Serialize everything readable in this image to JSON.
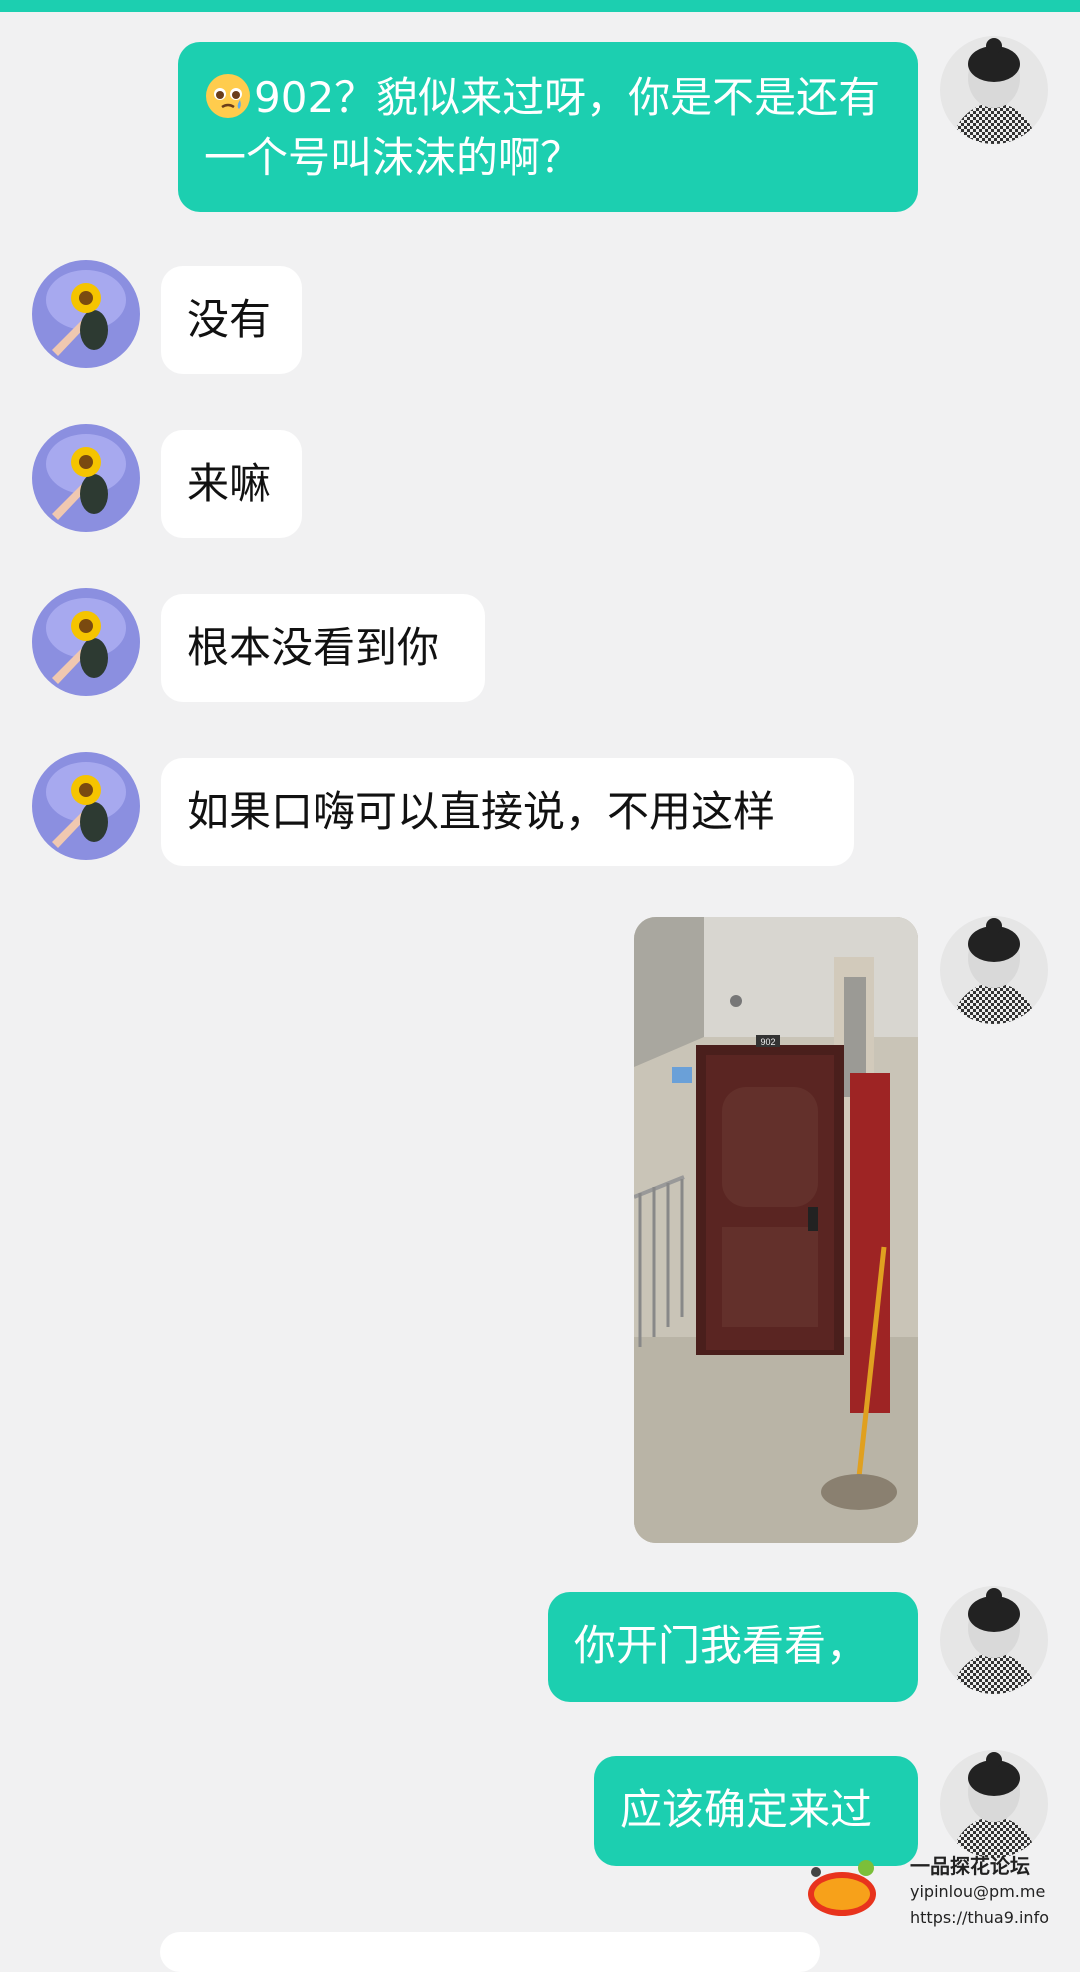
{
  "messages": [
    {
      "side": "out",
      "text": "902？貌似来过呀，你是不是还有一个号叫沫沫的啊？",
      "emoji": "pleading-face"
    },
    {
      "side": "in",
      "text": "没有"
    },
    {
      "side": "in",
      "text": "来嘛"
    },
    {
      "side": "in",
      "text": "根本没看到你"
    },
    {
      "side": "in",
      "text": "如果口嗨可以直接说，不用这样"
    },
    {
      "side": "out",
      "type": "image",
      "door_number": "902"
    },
    {
      "side": "out",
      "text": "你开门我看看，"
    },
    {
      "side": "out",
      "text": "应该确定来过"
    }
  ],
  "watermark": {
    "title": "一品探花论坛",
    "email": "yipinlou@pm.me",
    "url": "https://thua9.info"
  },
  "colors": {
    "accent": "#1ccfb0",
    "background": "#f1f1f2",
    "incoming_bubble": "#ffffff"
  }
}
